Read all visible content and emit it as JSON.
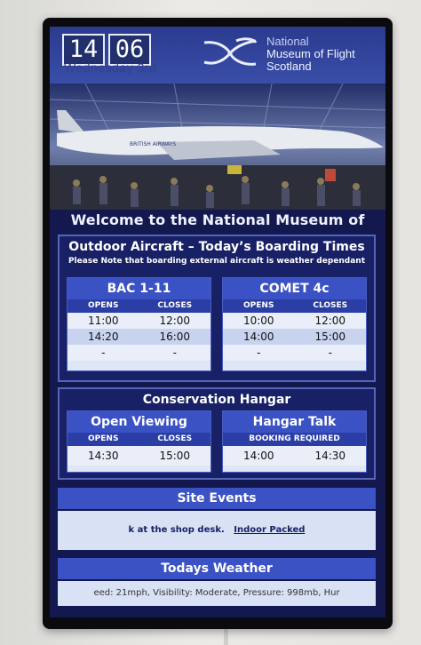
{
  "clock": {
    "hours": "14",
    "minutes": "06",
    "date": "Wednesday 3rd"
  },
  "logo": {
    "line1": "National",
    "line2": "Museum of Flight",
    "line3": "Scotland"
  },
  "welcome": "Welcome to the National Museum of Flight",
  "outdoor": {
    "title": "Outdoor Aircraft – Today’s Boarding  Times",
    "note": "Please Note that boarding external aircraft is weather dependant",
    "aircraft": [
      {
        "name": "BAC 1-11",
        "opens_label": "OPENS",
        "closes_label": "CLOSES",
        "rows": [
          [
            "11:00",
            "12:00"
          ],
          [
            "14:20",
            "16:00"
          ],
          [
            "-",
            "-"
          ]
        ]
      },
      {
        "name": "COMET 4c",
        "opens_label": "OPENS",
        "closes_label": "CLOSES",
        "rows": [
          [
            "10:00",
            "12:00"
          ],
          [
            "14:00",
            "15:00"
          ],
          [
            "-",
            "-"
          ]
        ]
      }
    ]
  },
  "conservation": {
    "title": "Conservation Hangar",
    "open_viewing": {
      "name": "Open Viewing",
      "opens_label": "OPENS",
      "closes_label": "CLOSES",
      "opens": "14:30",
      "closes": "15:00"
    },
    "hangar_talk": {
      "name": "Hangar Talk",
      "booking_label": "BOOKING REQUIRED",
      "time1": "14:00",
      "time2": "14:30"
    }
  },
  "site_events": {
    "title": "Site Events",
    "ticker_a": "k at the shop desk.",
    "ticker_b": "Indoor Packed"
  },
  "weather": {
    "title": "Todays Weather",
    "ticker": "eed: 21mph, Visibility: Moderate, Pressure: 998mb, Hur"
  },
  "colors": {
    "screen_bg": "#13184e",
    "accent": "#3b52c4",
    "header": "#2a3ea6"
  }
}
